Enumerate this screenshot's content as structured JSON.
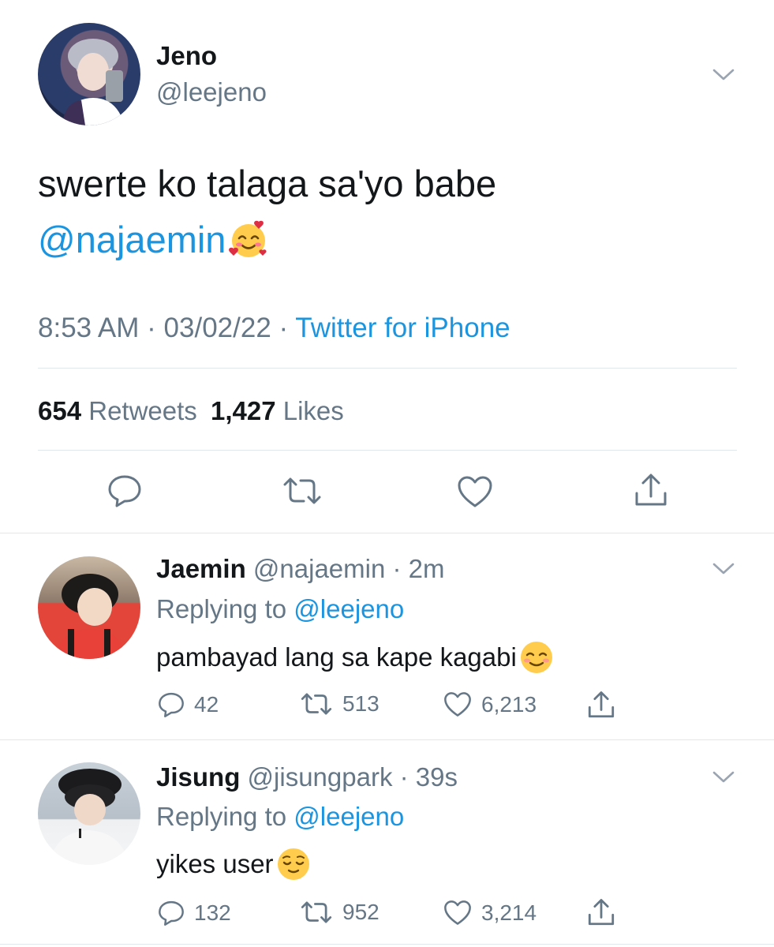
{
  "main_tweet": {
    "display_name": "Jeno",
    "handle": "@leejeno",
    "text": "swerte ko talaga sa'yo babe",
    "mention": "@najaemin",
    "time": "8:53 AM",
    "date": "03/02/22",
    "source": "Twitter for iPhone",
    "retweet_count": "654",
    "retweet_label": "Retweets",
    "like_count": "1,427",
    "like_label": "Likes"
  },
  "replies": [
    {
      "display_name": "Jaemin",
      "handle": "@najaemin",
      "time": "2m",
      "replying_label": "Replying to",
      "replying_to": "@leejeno",
      "text": "pambayad lang sa kape kagabi",
      "emoji": "smiling-face-icon",
      "reply_count": "42",
      "retweet_count": "513",
      "like_count": "6,213"
    },
    {
      "display_name": "Jisung",
      "handle": "@jisungpark",
      "time": "39s",
      "replying_label": "Replying to",
      "replying_to": "@leejeno",
      "text": "yikes user",
      "emoji": "relieved-face-icon",
      "reply_count": "132",
      "retweet_count": "952",
      "like_count": "3,214"
    }
  ],
  "colors": {
    "text": "#14171a",
    "secondary": "#657786",
    "link": "#1b95e0",
    "divider": "#e1e8ed",
    "emoji_yellow": "#ffcc4d"
  }
}
